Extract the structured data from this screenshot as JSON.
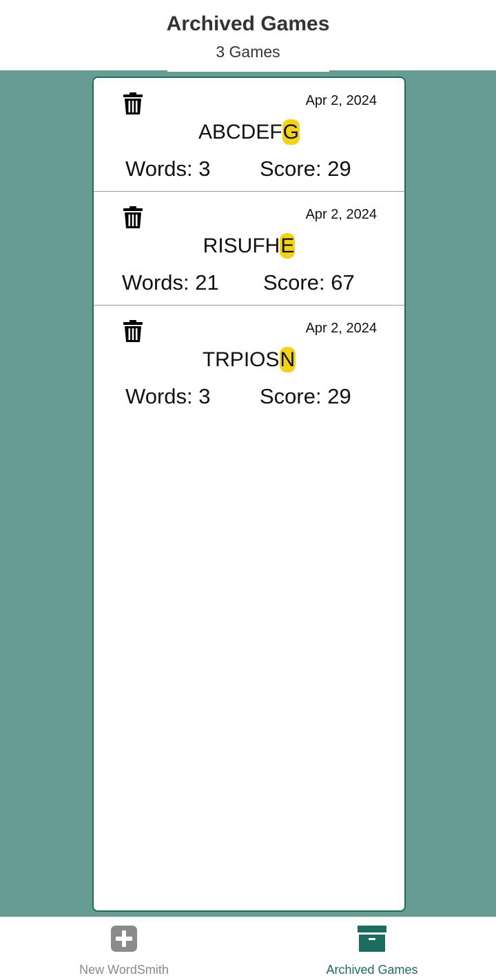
{
  "header": {
    "title": "Archived Games",
    "subtitle": "3 Games"
  },
  "games": [
    {
      "prefix": "ABCDEF",
      "center": "G",
      "date": "Apr 2, 2024",
      "words_label": "Words: 3",
      "score_label": "Score: 29"
    },
    {
      "prefix": "RISUFH",
      "center": "E",
      "date": "Apr 2, 2024",
      "words_label": "Words: 21",
      "score_label": "Score: 67"
    },
    {
      "prefix": "TRPIOS",
      "center": "N",
      "date": "Apr 2, 2024",
      "words_label": "Words: 3",
      "score_label": "Score: 29"
    }
  ],
  "footer": {
    "tabs": [
      {
        "label": "New WordSmith",
        "icon": "plus-square-icon",
        "active": false
      },
      {
        "label": "Archived Games",
        "icon": "archive-icon",
        "active": true
      }
    ]
  },
  "colors": {
    "background": "#669c92",
    "accent": "#1d6b5f",
    "center_letter_highlight": "#f3d21b",
    "inactive_tab": "#8a8a8a"
  }
}
